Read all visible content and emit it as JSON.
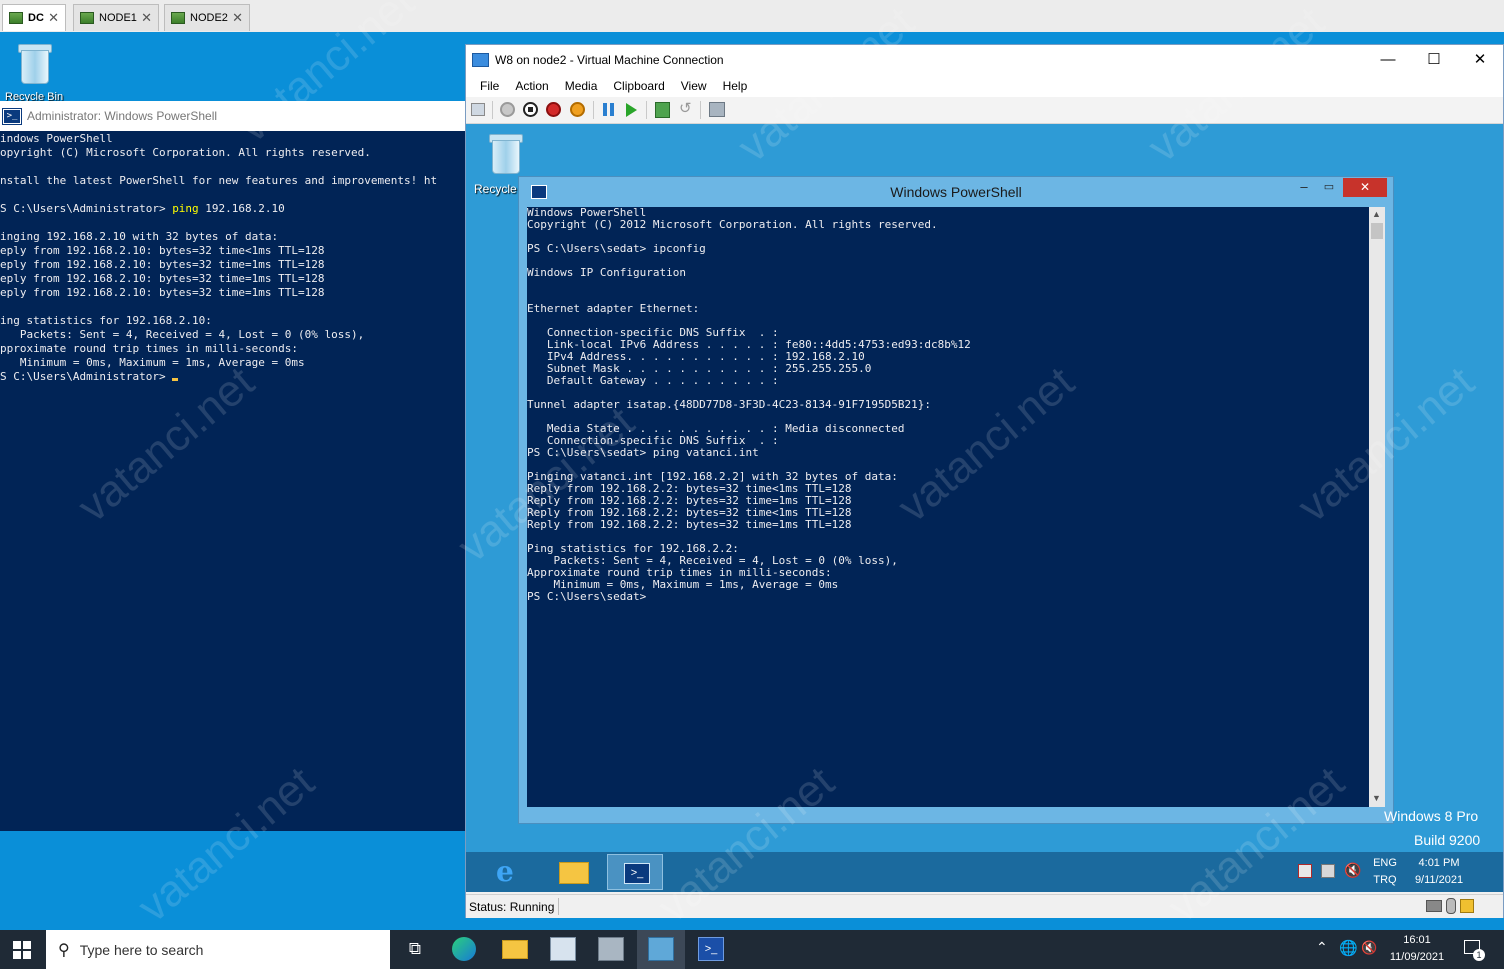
{
  "tabs": [
    {
      "label": "DC",
      "active": true
    },
    {
      "label": "NODE1",
      "active": false
    },
    {
      "label": "NODE2",
      "active": false
    }
  ],
  "host_desktop": {
    "recycle_bin_label": "Recycle Bin"
  },
  "host_powershell": {
    "title": "Administrator: Windows PowerShell",
    "lines": [
      "indows PowerShell",
      "opyright (C) Microsoft Corporation. All rights reserved.",
      "",
      "nstall the latest PowerShell for new features and improvements! ht",
      "",
      "",
      "",
      "inging 192.168.2.10 with 32 bytes of data:",
      "eply from 192.168.2.10: bytes=32 time<1ms TTL=128",
      "eply from 192.168.2.10: bytes=32 time=1ms TTL=128",
      "eply from 192.168.2.10: bytes=32 time=1ms TTL=128",
      "eply from 192.168.2.10: bytes=32 time=1ms TTL=128",
      "",
      "ing statistics for 192.168.2.10:",
      "   Packets: Sent = 4, Received = 4, Lost = 0 (0% loss),",
      "pproximate round trip times in milli-seconds:",
      "   Minimum = 0ms, Maximum = 1ms, Average = 0ms",
      "S C:\\Users\\Administrator> "
    ],
    "prompt_line": {
      "prompt": "S C:\\Users\\Administrator> ",
      "command": "ping",
      "args": " 192.168.2.10"
    }
  },
  "vm_window": {
    "title": "W8 on node2 - Virtual Machine Connection",
    "menu": [
      "File",
      "Action",
      "Media",
      "Clipboard",
      "View",
      "Help"
    ],
    "status": "Status: Running"
  },
  "guest": {
    "recycle_label": "Recycle",
    "edition": "Windows 8 Pro",
    "build": "Build 9200",
    "lang_top": "ENG",
    "lang_bottom": "TRQ",
    "time": "4:01 PM",
    "date": "9/11/2021",
    "powershell": {
      "title": "Windows PowerShell",
      "lines": [
        "Windows PowerShell",
        "Copyright (C) 2012 Microsoft Corporation. All rights reserved.",
        "",
        "PS C:\\Users\\sedat> ipconfig",
        "",
        "Windows IP Configuration",
        "",
        "",
        "Ethernet adapter Ethernet:",
        "",
        "   Connection-specific DNS Suffix  . :",
        "   Link-local IPv6 Address . . . . . : fe80::4dd5:4753:ed93:dc8b%12",
        "   IPv4 Address. . . . . . . . . . . : 192.168.2.10",
        "   Subnet Mask . . . . . . . . . . . : 255.255.255.0",
        "   Default Gateway . . . . . . . . . :",
        "",
        "Tunnel adapter isatap.{48DD77D8-3F3D-4C23-8134-91F7195D5B21}:",
        "",
        "   Media State . . . . . . . . . . . : Media disconnected",
        "   Connection-specific DNS Suffix  . :",
        "PS C:\\Users\\sedat> ping vatanci.int",
        "",
        "Pinging vatanci.int [192.168.2.2] with 32 bytes of data:",
        "Reply from 192.168.2.2: bytes=32 time<1ms TTL=128",
        "Reply from 192.168.2.2: bytes=32 time=1ms TTL=128",
        "Reply from 192.168.2.2: bytes=32 time<1ms TTL=128",
        "Reply from 192.168.2.2: bytes=32 time=1ms TTL=128",
        "",
        "Ping statistics for 192.168.2.2:",
        "    Packets: Sent = 4, Received = 4, Lost = 0 (0% loss),",
        "Approximate round trip times in milli-seconds:",
        "    Minimum = 0ms, Maximum = 1ms, Average = 0ms",
        "PS C:\\Users\\sedat>"
      ]
    }
  },
  "taskbar": {
    "search_placeholder": "Type here to search",
    "time": "16:01",
    "date": "11/09/2021",
    "notification_count": "1"
  },
  "watermark": "vatanci.net"
}
